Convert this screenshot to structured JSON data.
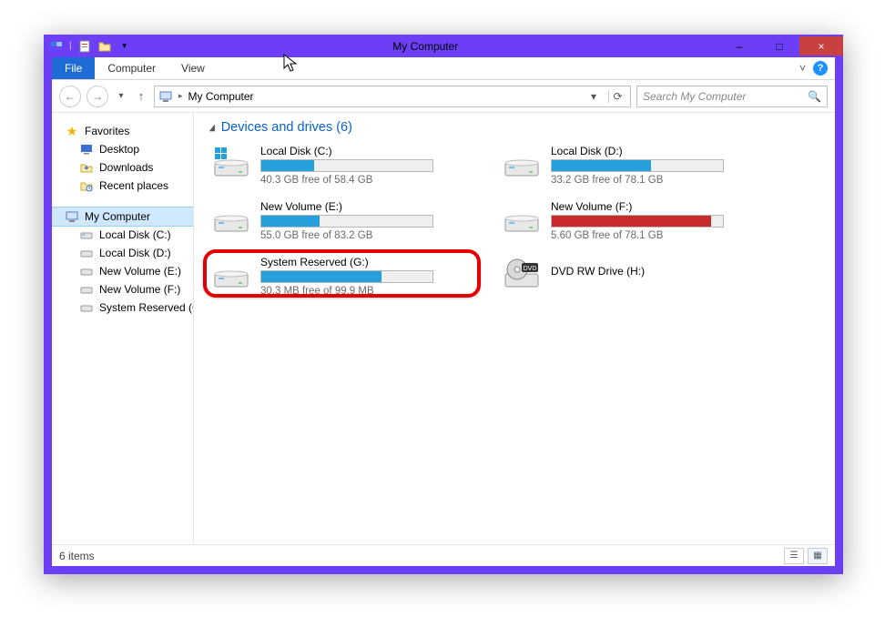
{
  "window": {
    "title": "My Computer",
    "minimize_label": "–",
    "maximize_label": "□",
    "close_label": "×"
  },
  "ribbon": {
    "file": "File",
    "computer": "Computer",
    "view": "View",
    "collapse_glyph": "˅",
    "help_label": "?"
  },
  "nav": {
    "back_glyph": "←",
    "forward_glyph": "→",
    "recent_glyph": "▾",
    "up_glyph": "↑",
    "path": "My Computer",
    "path_drop_glyph": "▾",
    "refresh_glyph": "⟳"
  },
  "search": {
    "placeholder": "Search My Computer",
    "icon_glyph": "🔍"
  },
  "sidebar": {
    "favorites_label": "Favorites",
    "favorites": [
      {
        "label": "Desktop"
      },
      {
        "label": "Downloads"
      },
      {
        "label": "Recent places"
      }
    ],
    "computer_label": "My Computer",
    "volumes": [
      {
        "label": "Local Disk (C:)"
      },
      {
        "label": "Local Disk (D:)"
      },
      {
        "label": "New Volume (E:)"
      },
      {
        "label": "New Volume (F:)"
      },
      {
        "label": "System Reserved (G:)"
      }
    ]
  },
  "section": {
    "heading": "Devices and drives (6)"
  },
  "drives": [
    {
      "name": "Local Disk (C:)",
      "free": "40.3 GB free of 58.4 GB",
      "fill_pct": 31,
      "color": "blue",
      "kind": "hdd-win",
      "highlighted": false
    },
    {
      "name": "Local Disk (D:)",
      "free": "33.2 GB free of 78.1 GB",
      "fill_pct": 58,
      "color": "blue",
      "kind": "hdd",
      "highlighted": false
    },
    {
      "name": "New Volume (E:)",
      "free": "55.0 GB free of 83.2 GB",
      "fill_pct": 34,
      "color": "blue",
      "kind": "hdd",
      "highlighted": false
    },
    {
      "name": "New Volume (F:)",
      "free": "5.60 GB free of 78.1 GB",
      "fill_pct": 93,
      "color": "red",
      "kind": "hdd",
      "highlighted": false
    },
    {
      "name": "System Reserved (G:)",
      "free": "30.3 MB free of 99.9 MB",
      "fill_pct": 70,
      "color": "blue",
      "kind": "hdd",
      "highlighted": true
    },
    {
      "name": "DVD RW Drive (H:)",
      "free": "",
      "fill_pct": 0,
      "color": "none",
      "kind": "dvd",
      "highlighted": false
    }
  ],
  "status": {
    "text": "6 items"
  }
}
